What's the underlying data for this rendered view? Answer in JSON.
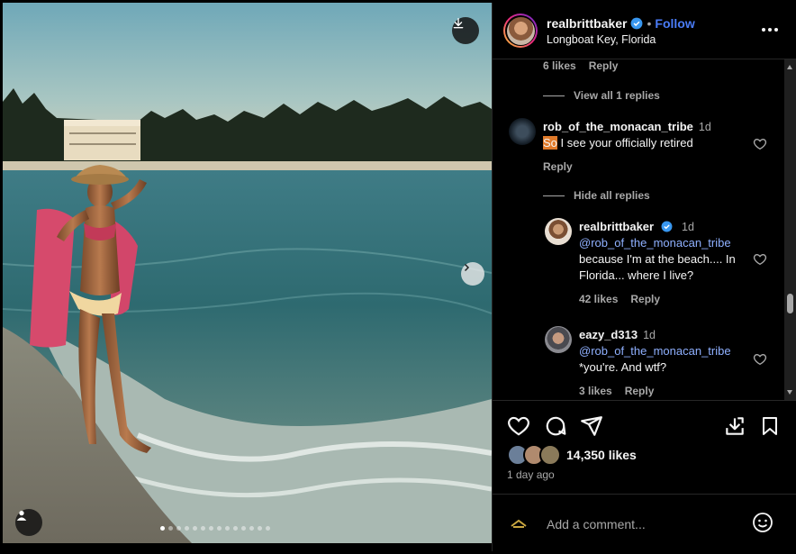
{
  "post": {
    "username": "realbrittbaker",
    "location": "Longboat Key, Florida",
    "follow_label": "Follow",
    "separator": "•"
  },
  "comments": {
    "top_reply_likes": "6 likes",
    "top_reply_label": "Reply",
    "view_replies": "View all 1 replies",
    "hide_replies": "Hide all replies",
    "items": [
      {
        "username": "rob_of_the_monacan_tribe",
        "time": "1d",
        "text_highlight": "So",
        "text": " I see your officially retired",
        "reply_label": "Reply"
      },
      {
        "username": "realbrittbaker",
        "time": "1d",
        "mention": "@rob_of_the_monacan_tribe",
        "text": "because I'm at the beach.... In Florida... where I live?",
        "likes": "42 likes",
        "reply_label": "Reply"
      },
      {
        "username": "eazy_d313",
        "time": "1d",
        "mention": "@rob_of_the_monacan_tribe",
        "text": "*you're. And wtf?",
        "likes": "3 likes",
        "reply_label": "Reply"
      }
    ]
  },
  "actions": {
    "icons": [
      "heart-icon",
      "comment-icon",
      "share-icon",
      "save-collection-icon",
      "bookmark-icon"
    ]
  },
  "likes": {
    "count": "14,350 likes",
    "time_ago": "1 day ago"
  },
  "add_comment": {
    "placeholder": "Add a comment...",
    "icon": "emoji-icon"
  },
  "carousel": {
    "total": 14,
    "current": 1
  },
  "colors": {
    "accent": "#4a7cf7",
    "verified": "#3897f0",
    "muted": "#a8a8a8",
    "highlight": "#e07a2a"
  }
}
